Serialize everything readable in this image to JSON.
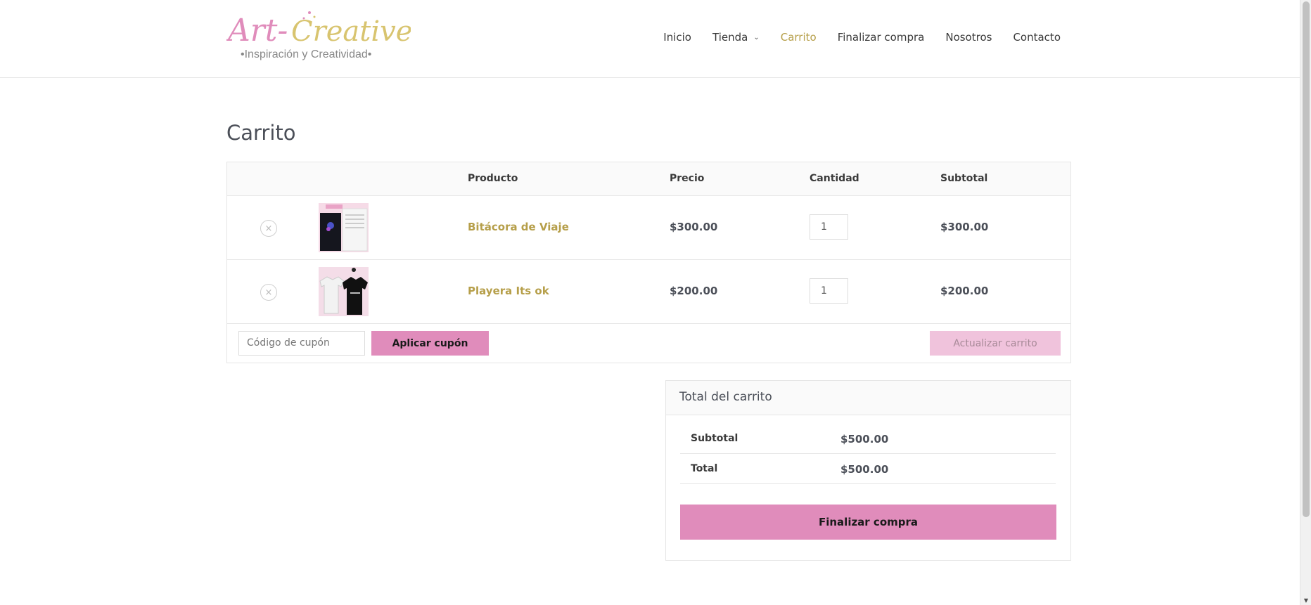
{
  "site": {
    "logo_main": "Art-Creative",
    "logo_tagline": "•Inspiración y Creatividad•",
    "brand_pink": "#e08cbb",
    "brand_gold": "#b69f4a"
  },
  "nav": {
    "items": [
      {
        "label": "Inicio"
      },
      {
        "label": "Tienda",
        "icon": "chevron-down-icon"
      },
      {
        "label": "Carrito",
        "active": true
      },
      {
        "label": "Finalizar compra"
      },
      {
        "label": "Nosotros"
      },
      {
        "label": "Contacto"
      }
    ]
  },
  "page": {
    "title": "Carrito"
  },
  "cart": {
    "headers": {
      "product": "Producto",
      "price": "Precio",
      "quantity": "Cantidad",
      "subtotal": "Subtotal"
    },
    "items": [
      {
        "name": "Bitácora de Viaje",
        "price": "$300.00",
        "quantity": "1",
        "subtotal": "$300.00"
      },
      {
        "name": "Playera Its ok",
        "price": "$200.00",
        "quantity": "1",
        "subtotal": "$200.00"
      }
    ],
    "coupon_placeholder": "Código de cupón",
    "apply_coupon_label": "Aplicar cupón",
    "update_cart_label": "Actualizar carrito"
  },
  "totals": {
    "title": "Total del carrito",
    "subtotal_label": "Subtotal",
    "subtotal_value": "$500.00",
    "total_label": "Total",
    "total_value": "$500.00",
    "checkout_label": "Finalizar compra"
  }
}
